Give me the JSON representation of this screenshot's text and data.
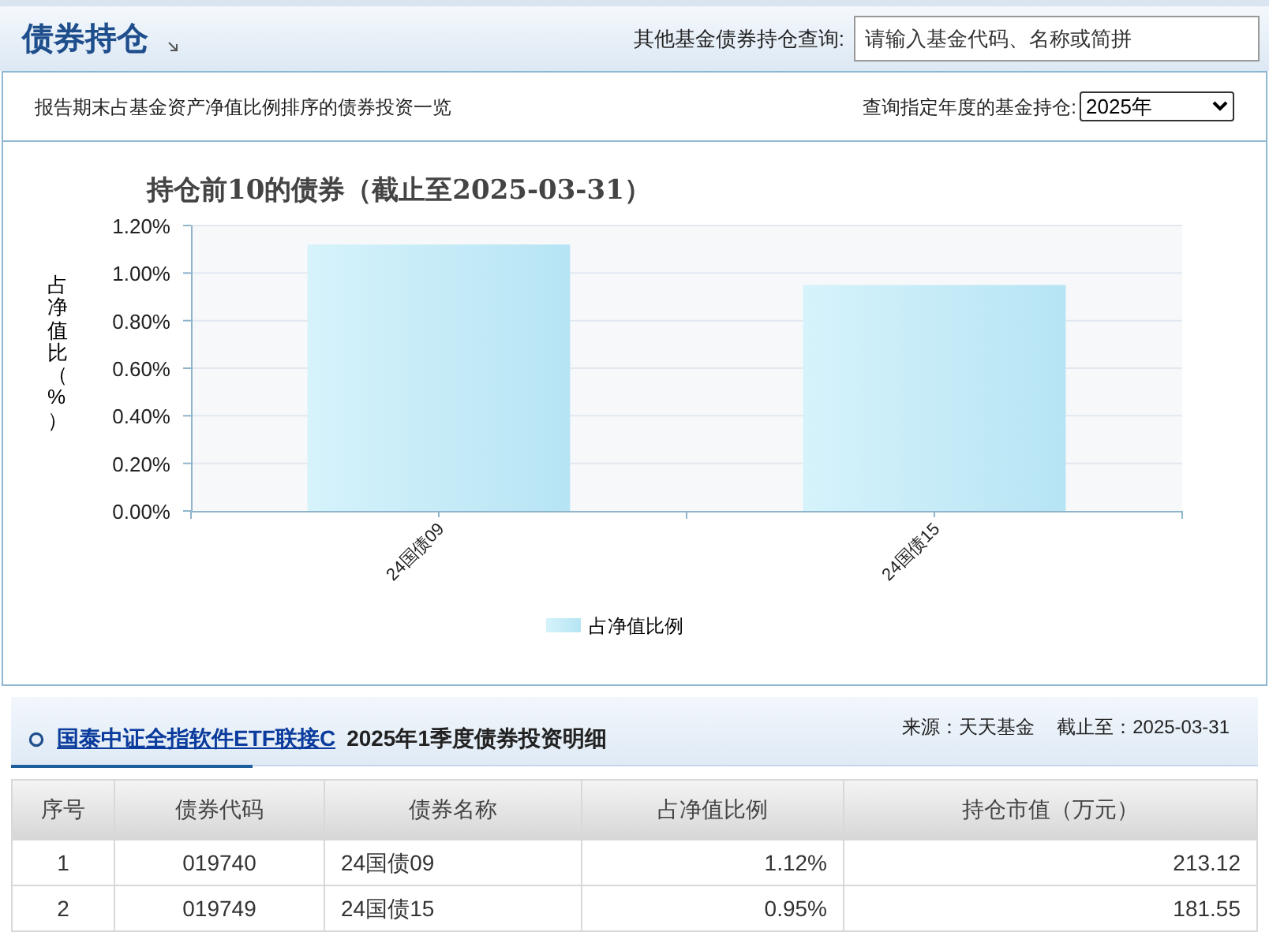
{
  "header": {
    "title": "债券持仓",
    "search_label": "其他基金债券持仓查询:",
    "search": {
      "placeholder": "请输入基金代码、名称或简拼"
    }
  },
  "summary": {
    "description": "报告期末占基金资产净值比例排序的债券投资一览",
    "year_label": "查询指定年度的基金持仓:",
    "year_select": {
      "value": "2025年"
    }
  },
  "chart_data": {
    "type": "bar",
    "title": "持仓前10的债券（截止至2025-03-31）",
    "ylabel": "占净值比（%）",
    "categories": [
      "24国债09",
      "24国债15"
    ],
    "series": [
      {
        "name": "占净值比例",
        "color": "#b6e4f4",
        "values": [
          1.12,
          0.95
        ]
      }
    ],
    "ylim": [
      0,
      1.2
    ],
    "grid": true,
    "yticks": [
      {
        "value": 0,
        "label": "0.00%"
      },
      {
        "value": 0.2,
        "label": "0.20%"
      },
      {
        "value": 0.4,
        "label": "0.40%"
      },
      {
        "value": 0.6,
        "label": "0.60%"
      },
      {
        "value": 0.8,
        "label": "0.80%"
      },
      {
        "value": 1.0,
        "label": "1.00%"
      },
      {
        "value": 1.2,
        "label": "1.20%"
      }
    ]
  },
  "detail": {
    "fund_link": "国泰中证全指软件ETF联接C",
    "title": "2025年1季度债券投资明细",
    "source": "来源：天天基金",
    "as_of": "截止至：2025-03-31"
  },
  "table": {
    "columns": [
      "序号",
      "债券代码",
      "债券名称",
      "占净值比例",
      "持仓市值（万元）"
    ],
    "rows": [
      [
        "1",
        "019740",
        "24国债09",
        "1.12%",
        "213.12"
      ],
      [
        "2",
        "019749",
        "24国债15",
        "0.95%",
        "181.55"
      ]
    ]
  }
}
